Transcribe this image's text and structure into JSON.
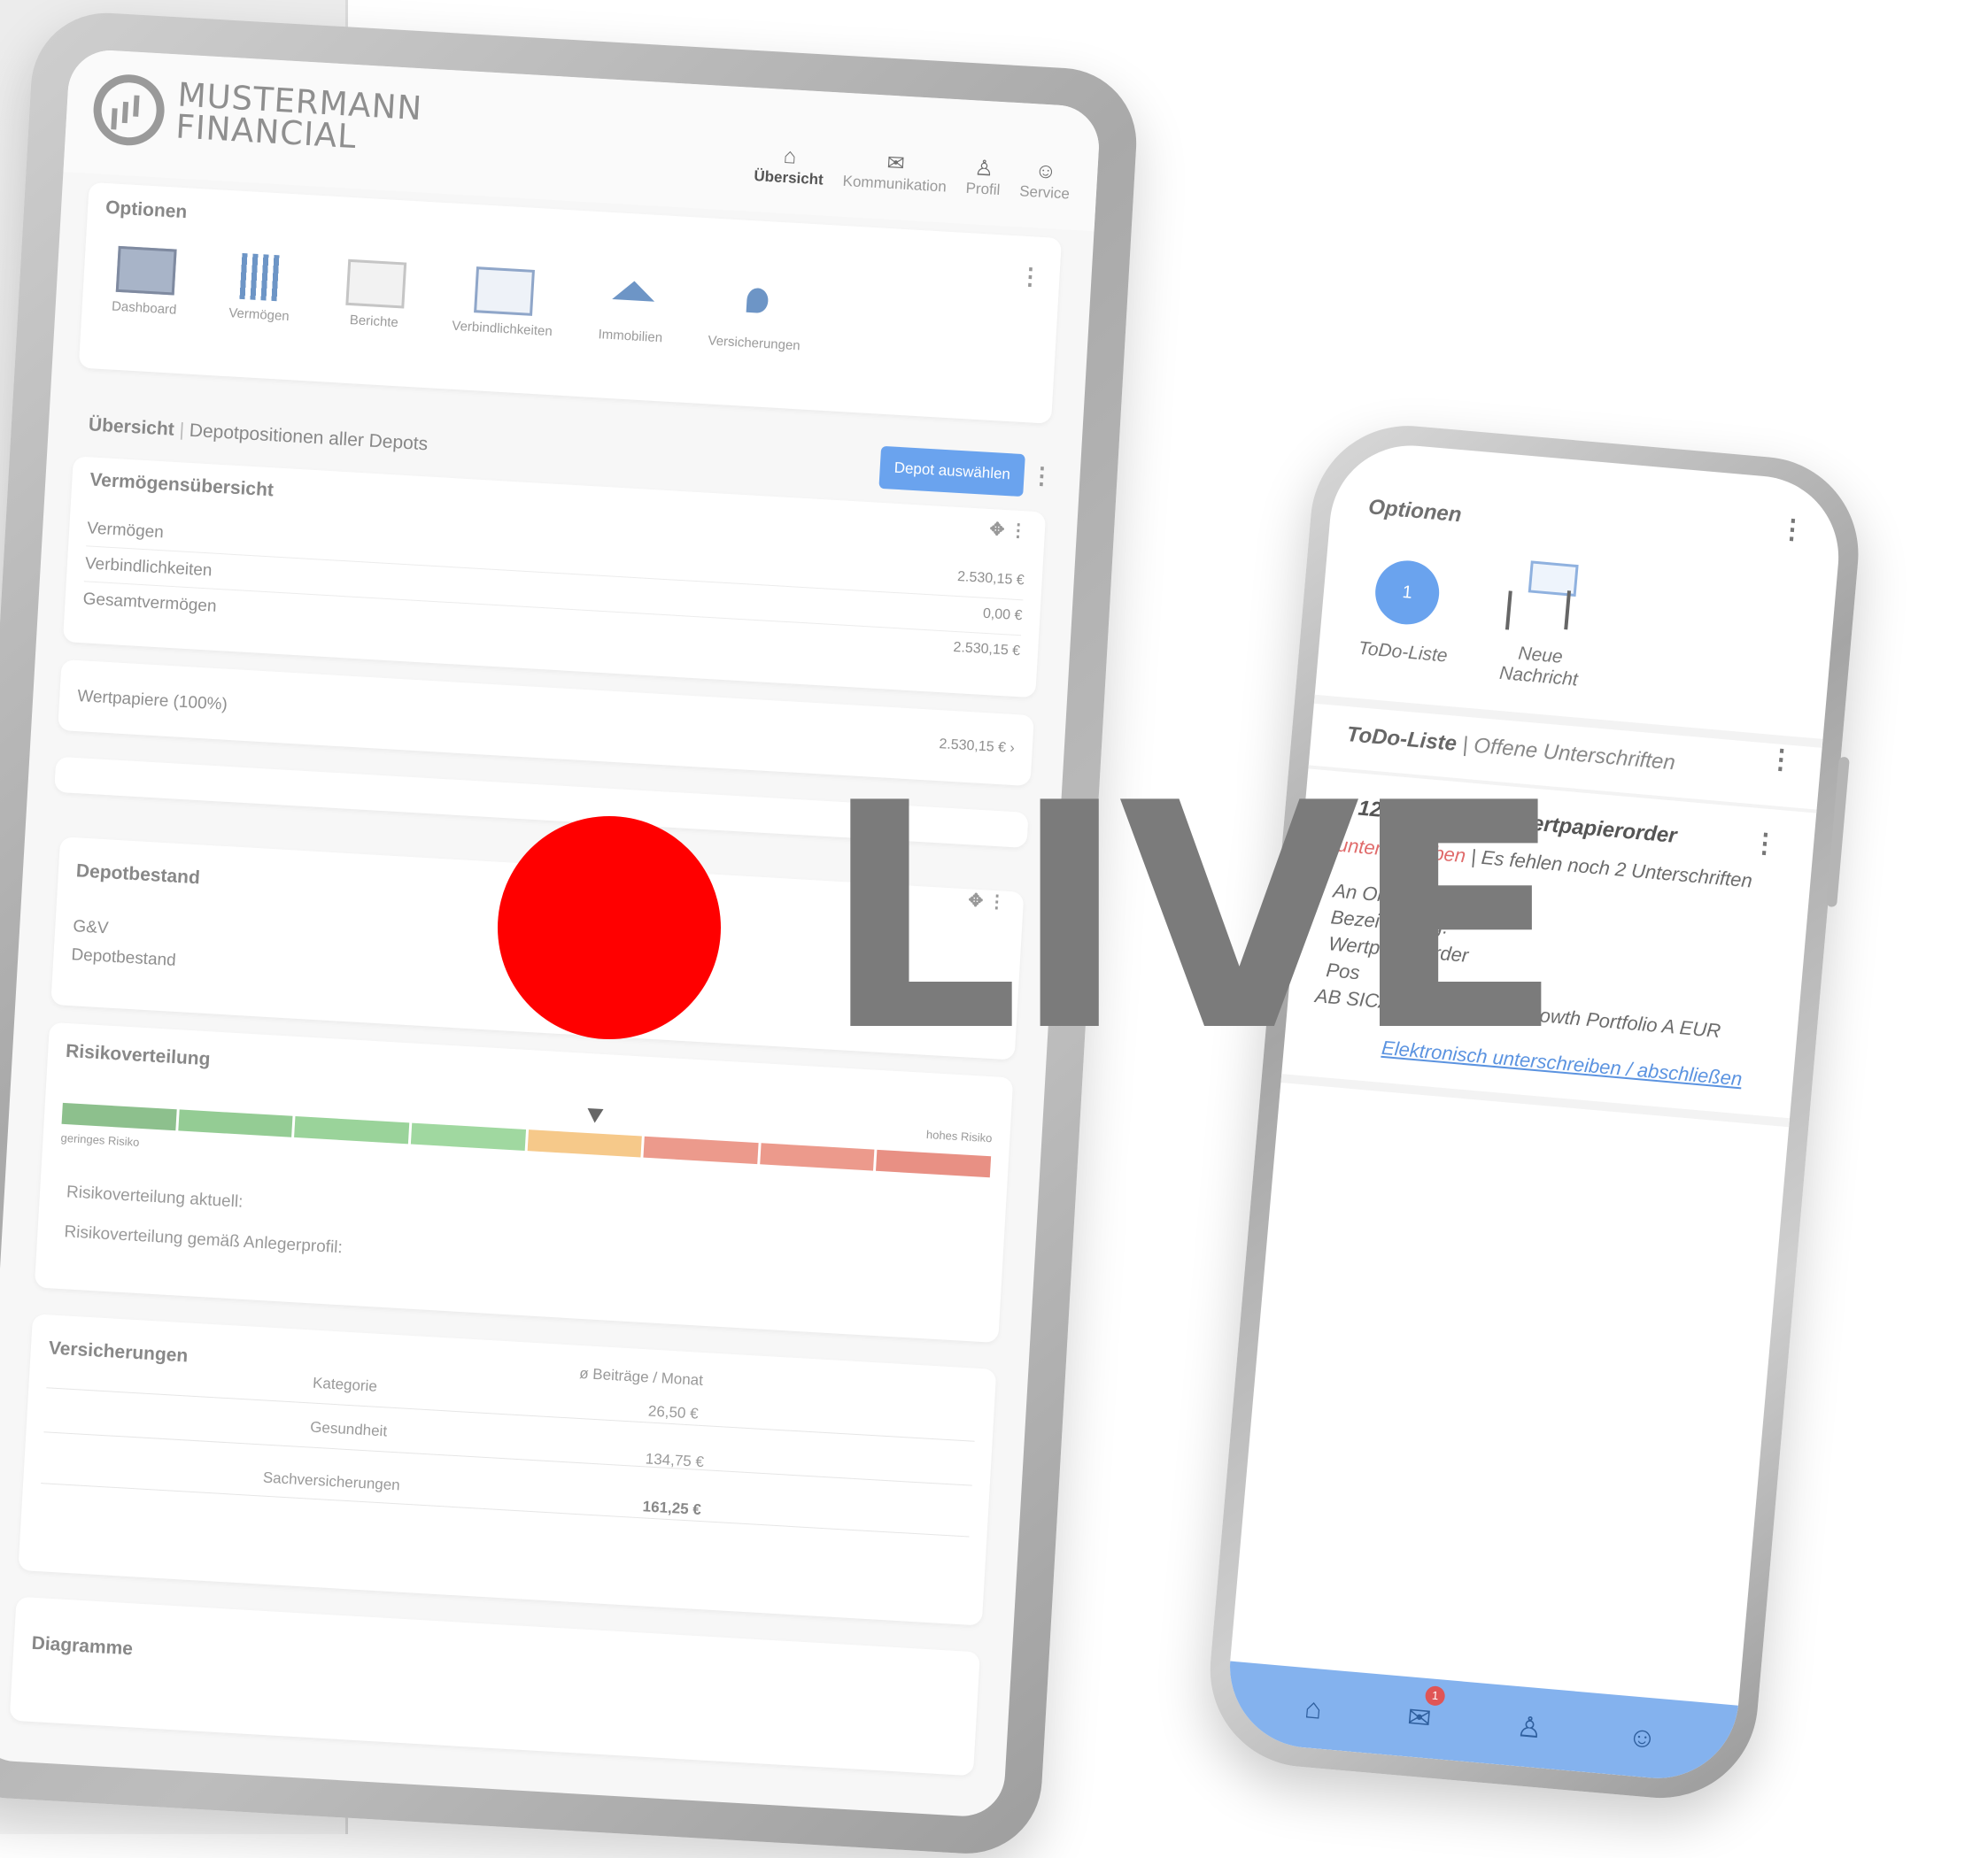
{
  "tablet": {
    "logo": {
      "line1": "MUSTERMANN",
      "line2": "FINANCIAL"
    },
    "nav": [
      {
        "label": "Übersicht",
        "icon": "⌂",
        "active": true
      },
      {
        "label": "Kommunikation",
        "icon": "✉",
        "active": false
      },
      {
        "label": "Profil",
        "icon": "♙",
        "active": false
      },
      {
        "label": "Service",
        "icon": "☺",
        "active": false
      }
    ],
    "options": {
      "title": "Optionen",
      "items": [
        "Dashboard",
        "Vermögen",
        "Berichte",
        "Verbindlichkeiten",
        "Immobilien",
        "Versicherungen"
      ]
    },
    "overview": {
      "title": "Übersicht",
      "subtitle": "Depotpositionen aller Depots",
      "button": "Depot auswählen"
    },
    "assets": {
      "title": "Vermögensübersicht",
      "rows": [
        {
          "label": "Vermögen",
          "value": "2.530,15 €"
        },
        {
          "label": "Verbindlichkeiten",
          "value": "0,00 €"
        },
        {
          "label": "Gesamtvermögen",
          "value": "2.530,15 €"
        }
      ],
      "securities": {
        "label": "Wertpapiere (100%)",
        "value": "2.530,15 €"
      }
    },
    "depot": {
      "title": "Depotbestand",
      "rows": [
        "G&V",
        "Depotbestand"
      ]
    },
    "risk": {
      "title": "Risikoverteilung",
      "low": "geringes Risiko",
      "high": "hohes Risiko",
      "current": "Risikoverteilung aktuell:",
      "profile": "Risikoverteilung gemäß Anlegerprofil:",
      "colors": [
        "#8dc08d",
        "#94cc94",
        "#9ad39a",
        "#a0d8a0",
        "#f6c98a",
        "#ec9a8c",
        "#ec9a8c",
        "#e89084"
      ]
    },
    "insurance": {
      "title": "Versicherungen",
      "headers": [
        "Kategorie",
        "ø Beiträge / Monat"
      ],
      "rows": [
        {
          "category": "Gesundheit",
          "value": "26,50 €"
        },
        {
          "category": "Sachversicherungen",
          "value": "134,75 €"
        },
        {
          "category": "",
          "value": "161,25 €"
        }
      ]
    },
    "charts": {
      "title": "Diagramme"
    }
  },
  "phone": {
    "options_title": "Optionen",
    "todo_count": "1",
    "todo_label": "ToDo-Liste",
    "new_message": "Neue Nachricht",
    "section_title": "ToDo-Liste",
    "section_subtitle": "Offene Unterschriften",
    "item": {
      "header": "12.2016 15:34 | Wertpapierorder",
      "status": "unterschrieben",
      "missing": "| Es fehlen noch 2 Unterschriften",
      "line1": "An Ordnung",
      "line2": "Bezeichnung:",
      "line3": "Wertpapierorder",
      "line4": "Pos",
      "line5": "AB SICAV I - American Growth Portfolio A EUR",
      "link": "Elektronisch unterschreiben / abschließen"
    },
    "nav_badge": "1"
  },
  "live": {
    "text": "LIVE",
    "dot_color": "#ff0000"
  }
}
